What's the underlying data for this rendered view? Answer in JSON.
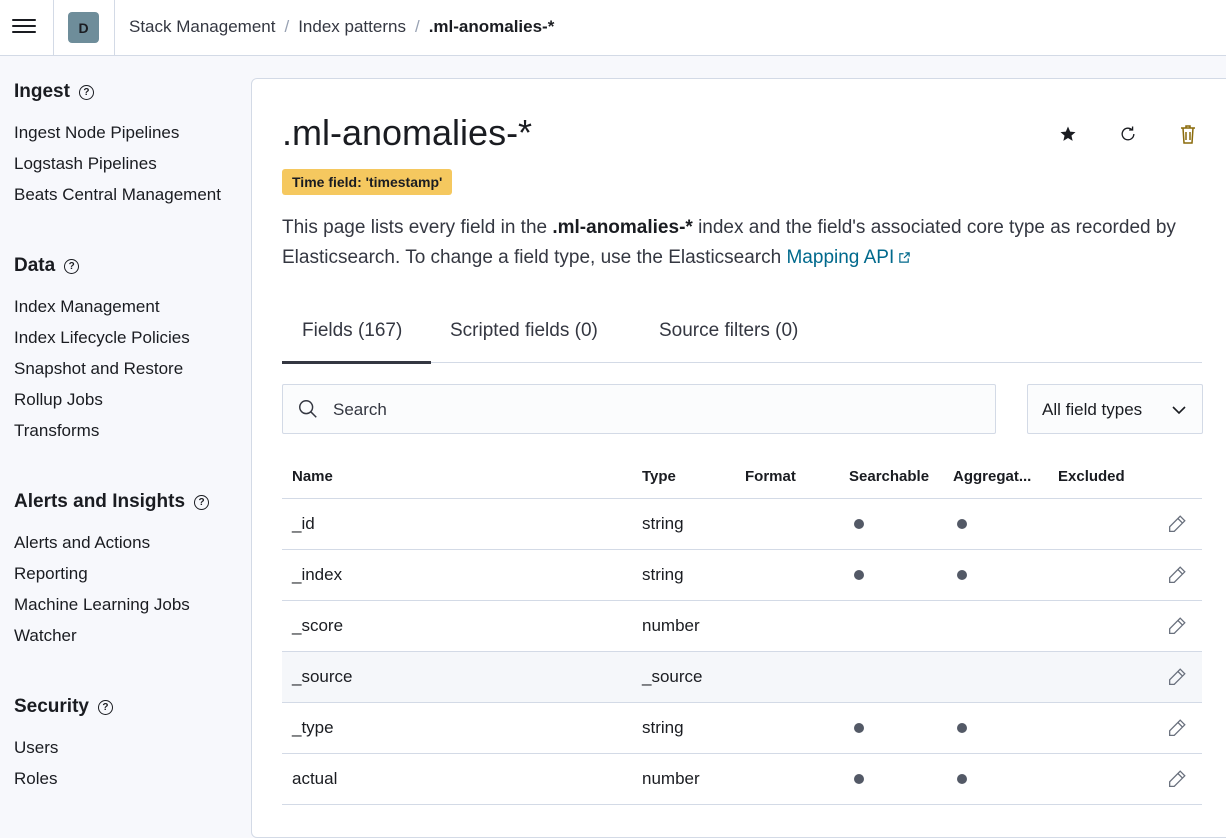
{
  "breadcrumbs": [
    "Stack Management",
    "Index patterns",
    ".ml-anomalies-*"
  ],
  "space_initial": "D",
  "sidebar": {
    "groups": [
      {
        "title": "Ingest",
        "items": [
          "Ingest Node Pipelines",
          "Logstash Pipelines",
          "Beats Central Management"
        ]
      },
      {
        "title": "Data",
        "items": [
          "Index Management",
          "Index Lifecycle Policies",
          "Snapshot and Restore",
          "Rollup Jobs",
          "Transforms"
        ]
      },
      {
        "title": "Alerts and Insights",
        "items": [
          "Alerts and Actions",
          "Reporting",
          "Machine Learning Jobs",
          "Watcher"
        ]
      },
      {
        "title": "Security",
        "items": [
          "Users",
          "Roles"
        ]
      }
    ],
    "help_glyph": "?"
  },
  "page": {
    "title": ".ml-anomalies-*",
    "time_badge": "Time field: 'timestamp'",
    "desc_part1": "This page lists every field in the ",
    "desc_index": ".ml-anomalies-*",
    "desc_part2": " index and the field's associated core type as recorded by Elasticsearch. To change a field type, use the Elasticsearch ",
    "desc_link": "Mapping API"
  },
  "actions": {
    "favorite_icon": "star-icon",
    "refresh_icon": "refresh-icon",
    "delete_icon": "trash-icon"
  },
  "tabs": [
    "Fields (167)",
    "Scripted fields (0)",
    "Source filters (0)"
  ],
  "search": {
    "placeholder": "Search"
  },
  "type_filter": {
    "value": "All field types"
  },
  "table": {
    "columns": [
      "Name",
      "Type",
      "Format",
      "Searchable",
      "Aggregat...",
      "Excluded"
    ],
    "rows": [
      {
        "name": "_id",
        "type": "string",
        "searchable": true,
        "aggregatable": true
      },
      {
        "name": "_index",
        "type": "string",
        "searchable": true,
        "aggregatable": true
      },
      {
        "name": "_score",
        "type": "number",
        "searchable": false,
        "aggregatable": false
      },
      {
        "name": "_source",
        "type": "_source",
        "searchable": false,
        "aggregatable": false
      },
      {
        "name": "_type",
        "type": "string",
        "searchable": true,
        "aggregatable": true
      },
      {
        "name": "actual",
        "type": "number",
        "searchable": true,
        "aggregatable": true
      }
    ]
  },
  "colors": {
    "accent_link": "#00698c",
    "badge": "#f5c85f",
    "text": "#1a1c21",
    "border": "#d3dae6"
  }
}
